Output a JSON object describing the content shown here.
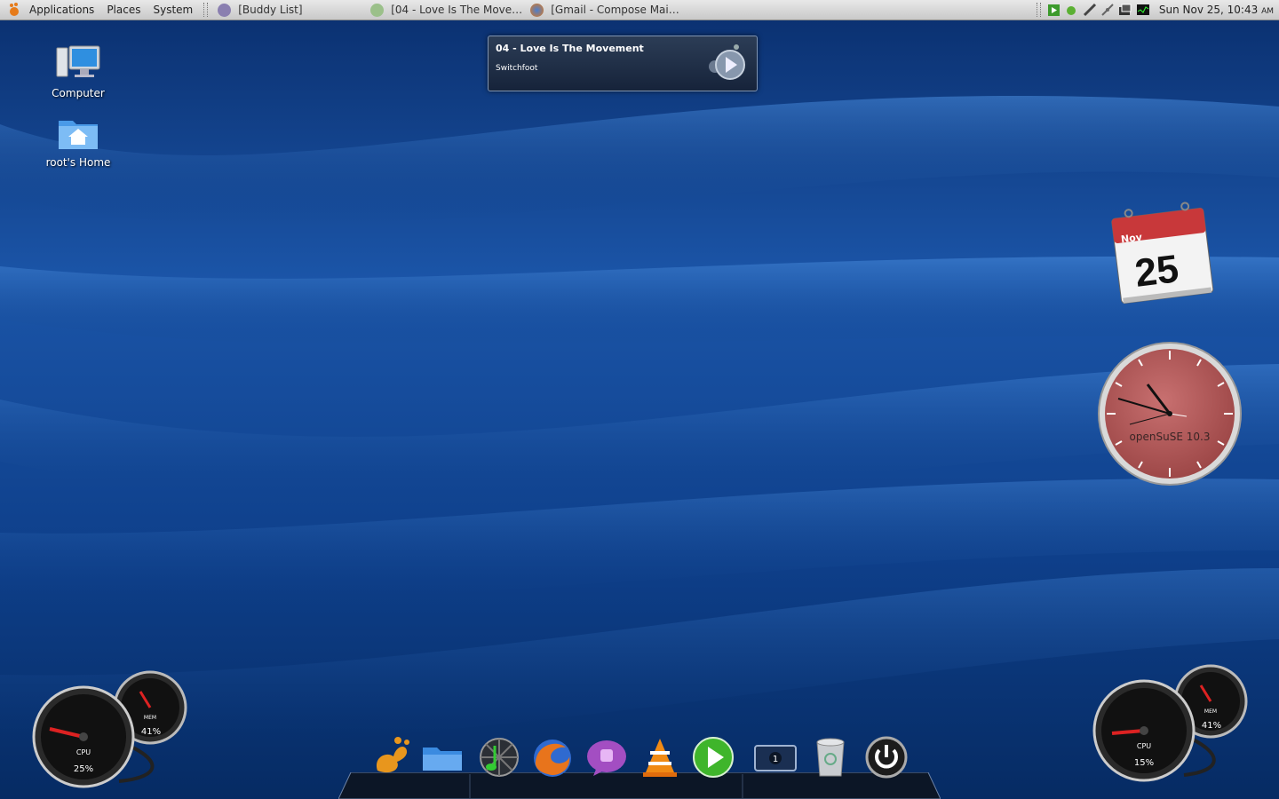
{
  "panel": {
    "menus": [
      "Applications",
      "Places",
      "System"
    ],
    "tasks": [
      "[Buddy List]",
      "[04 - Love Is The Move…",
      "[Gmail - Compose Mai…"
    ],
    "clock": {
      "text": "Sun Nov 25, 10:43",
      "ampm": "AM"
    }
  },
  "desktop_icons": {
    "computer": "Computer",
    "home": "root's Home"
  },
  "now_playing": {
    "title": "04 - Love Is The Movement",
    "artist": "Switchfoot"
  },
  "calendar": {
    "month": "Nov",
    "day": "25"
  },
  "analog_clock": {
    "label": "openSuSE 10.3"
  },
  "gauges_left": {
    "cpu_pct": "25%",
    "mem_pct": "41%"
  },
  "gauges_right": {
    "cpu_pct": "15%",
    "mem_pct": "41%"
  },
  "dock": {
    "items": [
      "gimp-icon",
      "files-icon",
      "music-player-icon",
      "firefox-icon",
      "pidgin-icon",
      "vlc-icon",
      "media-play-icon",
      "workspace-switcher-icon",
      "trash-icon",
      "power-icon"
    ]
  },
  "colors": {
    "wallpaper": "#0d3b82",
    "panel": "#d8d8d8",
    "clock_face": "#b25a5a"
  }
}
